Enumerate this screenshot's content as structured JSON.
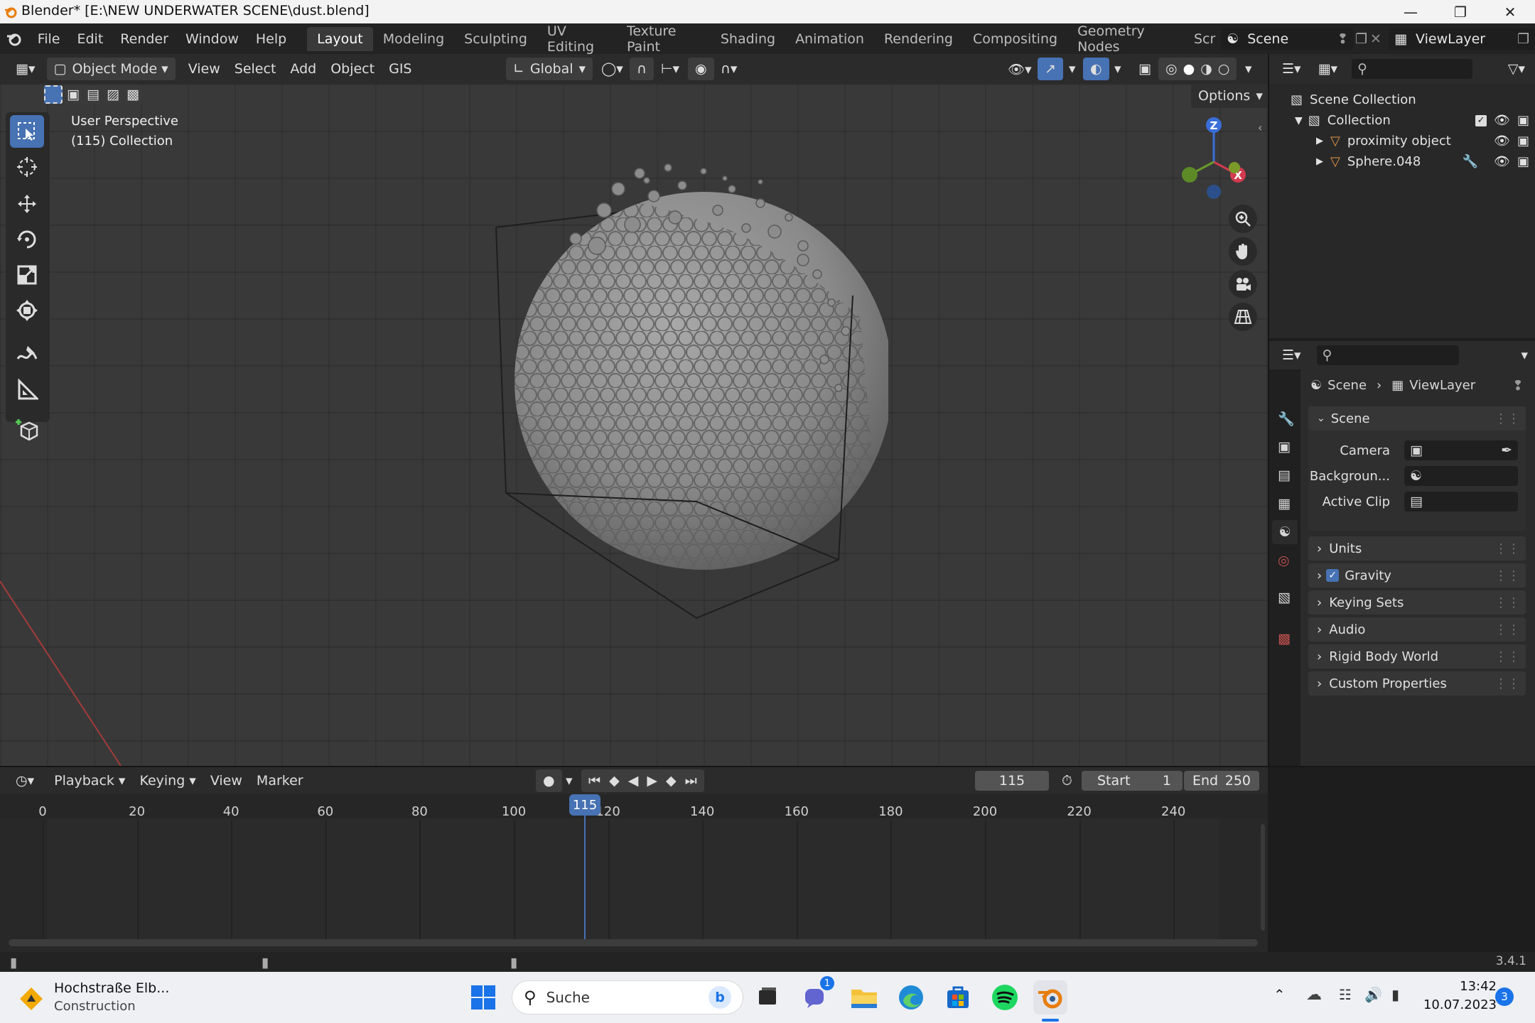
{
  "window": {
    "title": "Blender* [E:\\NEW UNDERWATER SCENE\\dust.blend]",
    "minimize_icon": "minimize-icon",
    "maximize_icon": "restore-icon",
    "close_icon": "close-icon"
  },
  "menubar": {
    "items": [
      "File",
      "Edit",
      "Render",
      "Window",
      "Help"
    ],
    "workspaces": [
      "Layout",
      "Modeling",
      "Sculpting",
      "UV Editing",
      "Texture Paint",
      "Shading",
      "Animation",
      "Rendering",
      "Compositing",
      "Geometry Nodes",
      "Scrip"
    ],
    "active_workspace": "Layout",
    "scene_name": "Scene",
    "view_layer": "ViewLayer"
  },
  "viewport_header": {
    "mode": "Object Mode",
    "menus": [
      "View",
      "Select",
      "Add",
      "Object",
      "GIS"
    ],
    "transform_orientation": "Global",
    "options_label": "Options"
  },
  "viewport": {
    "perspective": "User Perspective",
    "collection_info": "(115) Collection",
    "gizmo": {
      "x": "X",
      "y": "Y",
      "z": "Z"
    }
  },
  "outliner": {
    "root": "Scene Collection",
    "collection": "Collection",
    "objects": [
      "proximity object",
      "Sphere.048"
    ]
  },
  "properties": {
    "breadcrumb_scene": "Scene",
    "breadcrumb_layer": "ViewLayer",
    "panel_title": "Scene",
    "fields": [
      "Camera",
      "Backgroun...",
      "Active Clip"
    ],
    "subpanels": [
      "Units",
      "Gravity",
      "Keying Sets",
      "Audio",
      "Rigid Body World",
      "Custom Properties"
    ],
    "gravity_checked": true
  },
  "timeline": {
    "menus": [
      "Playback",
      "Keying",
      "View",
      "Marker"
    ],
    "current_frame": "115",
    "start_label": "Start",
    "start_value": "1",
    "end_label": "End",
    "end_value": "250",
    "ticks": [
      "0",
      "20",
      "40",
      "60",
      "80",
      "100",
      "120",
      "140",
      "160",
      "180",
      "200",
      "220",
      "240"
    ]
  },
  "statusbar": {
    "version": "3.4.1"
  },
  "taskbar": {
    "weather_title": "Hochstraße Elb...",
    "weather_sub": "Construction",
    "search_placeholder": "Suche",
    "chat_badge": "1",
    "time": "13:42",
    "date": "10.07.2023",
    "notif_count": "3"
  },
  "colors": {
    "accent": "#4772b3",
    "bg": "#393939",
    "panel": "#2b2b2b",
    "taskbar": "#eef0f4"
  }
}
